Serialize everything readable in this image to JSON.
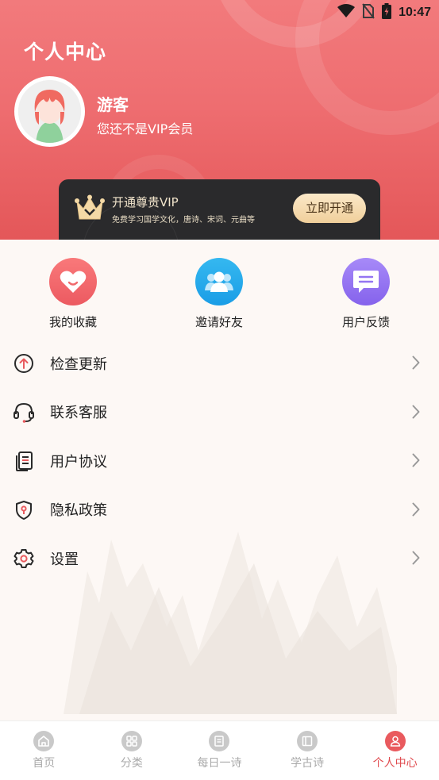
{
  "status_bar": {
    "time": "10:47"
  },
  "header": {
    "title": "个人中心"
  },
  "user": {
    "name": "游客",
    "status": "您还不是VIP会员"
  },
  "vip": {
    "title": "开通尊贵VIP",
    "description": "免费学习国学文化，唐诗、宋词、元曲等",
    "button": "立即开通"
  },
  "actions": [
    {
      "label": "我的收藏",
      "icon": "heart-icon",
      "color": "#f06a6d"
    },
    {
      "label": "邀请好友",
      "icon": "users-icon",
      "color": "#26a9ea"
    },
    {
      "label": "用户反馈",
      "icon": "message-icon",
      "color": "#9475f2"
    }
  ],
  "menu": [
    {
      "label": "检查更新",
      "icon": "update-icon"
    },
    {
      "label": "联系客服",
      "icon": "headset-icon"
    },
    {
      "label": "用户协议",
      "icon": "document-icon"
    },
    {
      "label": "隐私政策",
      "icon": "shield-icon"
    },
    {
      "label": "设置",
      "icon": "gear-icon"
    }
  ],
  "nav": [
    {
      "label": "首页",
      "icon": "home-icon",
      "active": false
    },
    {
      "label": "分类",
      "icon": "grid-icon",
      "active": false
    },
    {
      "label": "每日一诗",
      "icon": "poem-icon",
      "active": false
    },
    {
      "label": "学古诗",
      "icon": "book-icon",
      "active": false
    },
    {
      "label": "个人中心",
      "icon": "person-icon",
      "active": true
    }
  ],
  "colors": {
    "accent": "#e95a5e",
    "header": "#ee6d70",
    "vip_card": "#2a2a2c",
    "vip_button": "#f5dbb0"
  }
}
